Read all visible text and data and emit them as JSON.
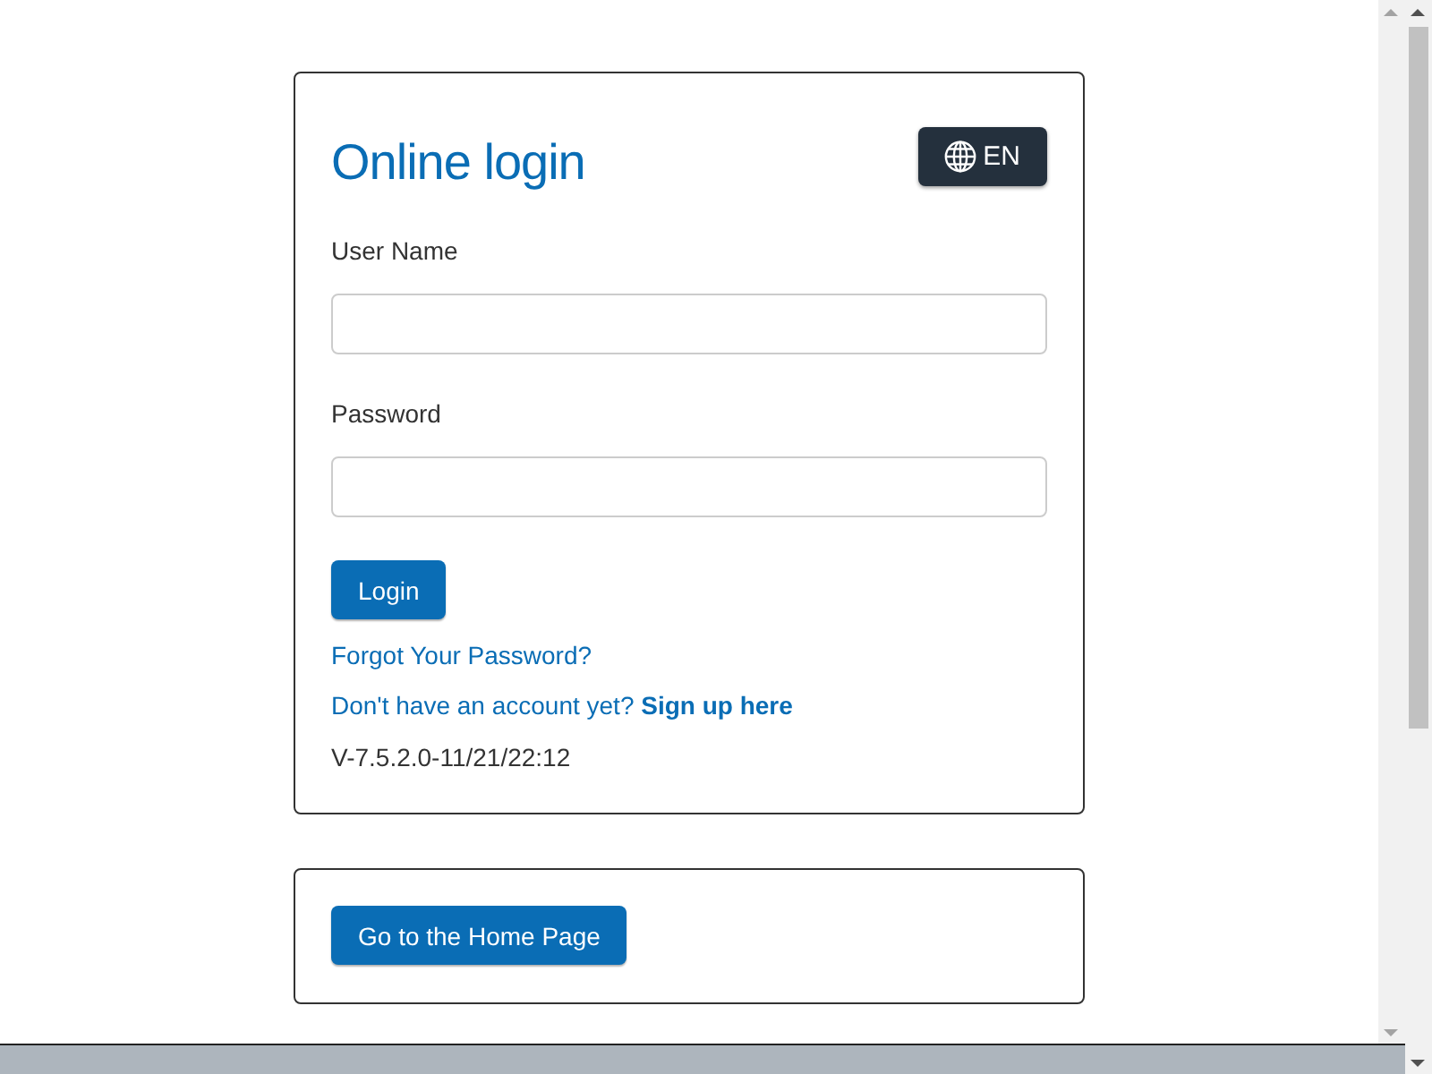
{
  "login_card": {
    "title": "Online login",
    "language_button": "EN",
    "fields": [
      {
        "label": "User Name"
      },
      {
        "label": "Password"
      }
    ],
    "login_button": "Login",
    "forgot_link": "Forgot Your Password?",
    "signup_prompt": "Don't have an account yet?",
    "signup_link": "Sign up here",
    "version": "V-7.5.2.0-11/21/22:12"
  },
  "home_card": {
    "button": "Go to the Home Page"
  }
}
